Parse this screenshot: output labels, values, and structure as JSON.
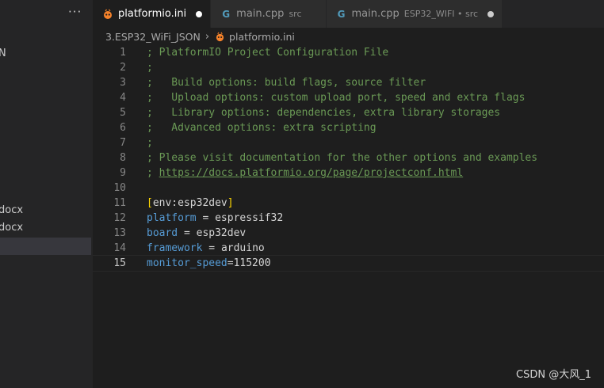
{
  "sidebar": {
    "more_label": "···",
    "items": [
      {
        "label": "N"
      },
      {
        "label": "docx"
      },
      {
        "label": "docx"
      }
    ]
  },
  "tabs": [
    {
      "label": "platformio.ini",
      "description": "",
      "icon": "platformio-icon",
      "active": true,
      "dirty": true
    },
    {
      "label": "main.cpp",
      "description": "src",
      "icon": "cpp-file-icon",
      "active": false,
      "dirty": false
    },
    {
      "label": "main.cpp",
      "description": "ESP32_WIFI • src",
      "icon": "cpp-file-icon",
      "active": false,
      "dirty": true
    }
  ],
  "breadcrumb": {
    "folder": "3.ESP32_WiFi_JSON",
    "file": "platformio.ini"
  },
  "editor": {
    "lines": [
      {
        "n": "1",
        "text": "; PlatformIO Project Configuration File"
      },
      {
        "n": "2",
        "text": ";"
      },
      {
        "n": "3",
        "text": ";   Build options: build flags, source filter"
      },
      {
        "n": "4",
        "text": ";   Upload options: custom upload port, speed and extra flags"
      },
      {
        "n": "5",
        "text": ";   Library options: dependencies, extra library storages"
      },
      {
        "n": "6",
        "text": ";   Advanced options: extra scripting"
      },
      {
        "n": "7",
        "text": ";"
      },
      {
        "n": "8",
        "text": "; Please visit documentation for the other options and examples"
      },
      {
        "n": "9",
        "prefix": "; ",
        "link": "https://docs.platformio.org/page/projectconf.html"
      },
      {
        "n": "10",
        "text": ""
      },
      {
        "n": "11",
        "open": "[",
        "section": "env:esp32dev",
        "close": "]"
      },
      {
        "n": "12",
        "key": "platform",
        "op": " = ",
        "value": "espressif32"
      },
      {
        "n": "13",
        "key": "board",
        "op": " = ",
        "value": "esp32dev"
      },
      {
        "n": "14",
        "key": "framework",
        "op": " = ",
        "value": "arduino"
      },
      {
        "n": "15",
        "key": "monitor_speed",
        "op": "=",
        "value": "115200"
      }
    ]
  },
  "watermark": "CSDN @大风_1",
  "colors": {
    "comment": "#6a9955",
    "key": "#569cd6",
    "bracket": "#ffd700",
    "platformio_icon": "#f5822a",
    "cpp_icon": "#519aba"
  }
}
